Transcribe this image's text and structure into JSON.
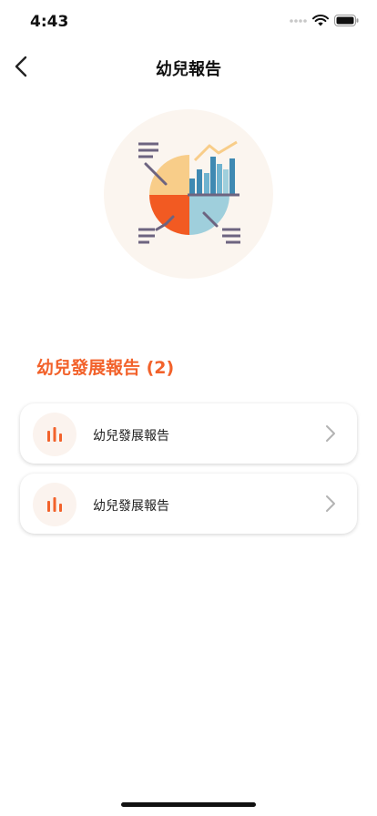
{
  "status_bar": {
    "time": "4:43"
  },
  "nav": {
    "title": "幼兒報告"
  },
  "section": {
    "title": "幼兒發展報告 (2)"
  },
  "reports": [
    {
      "label": "幼兒發展報告"
    },
    {
      "label": "幼兒發展報告"
    }
  ],
  "colors": {
    "accent": "#f2622b",
    "card_icon_bg": "#fbf3ee",
    "hero_bg": "#fbf5ef"
  }
}
